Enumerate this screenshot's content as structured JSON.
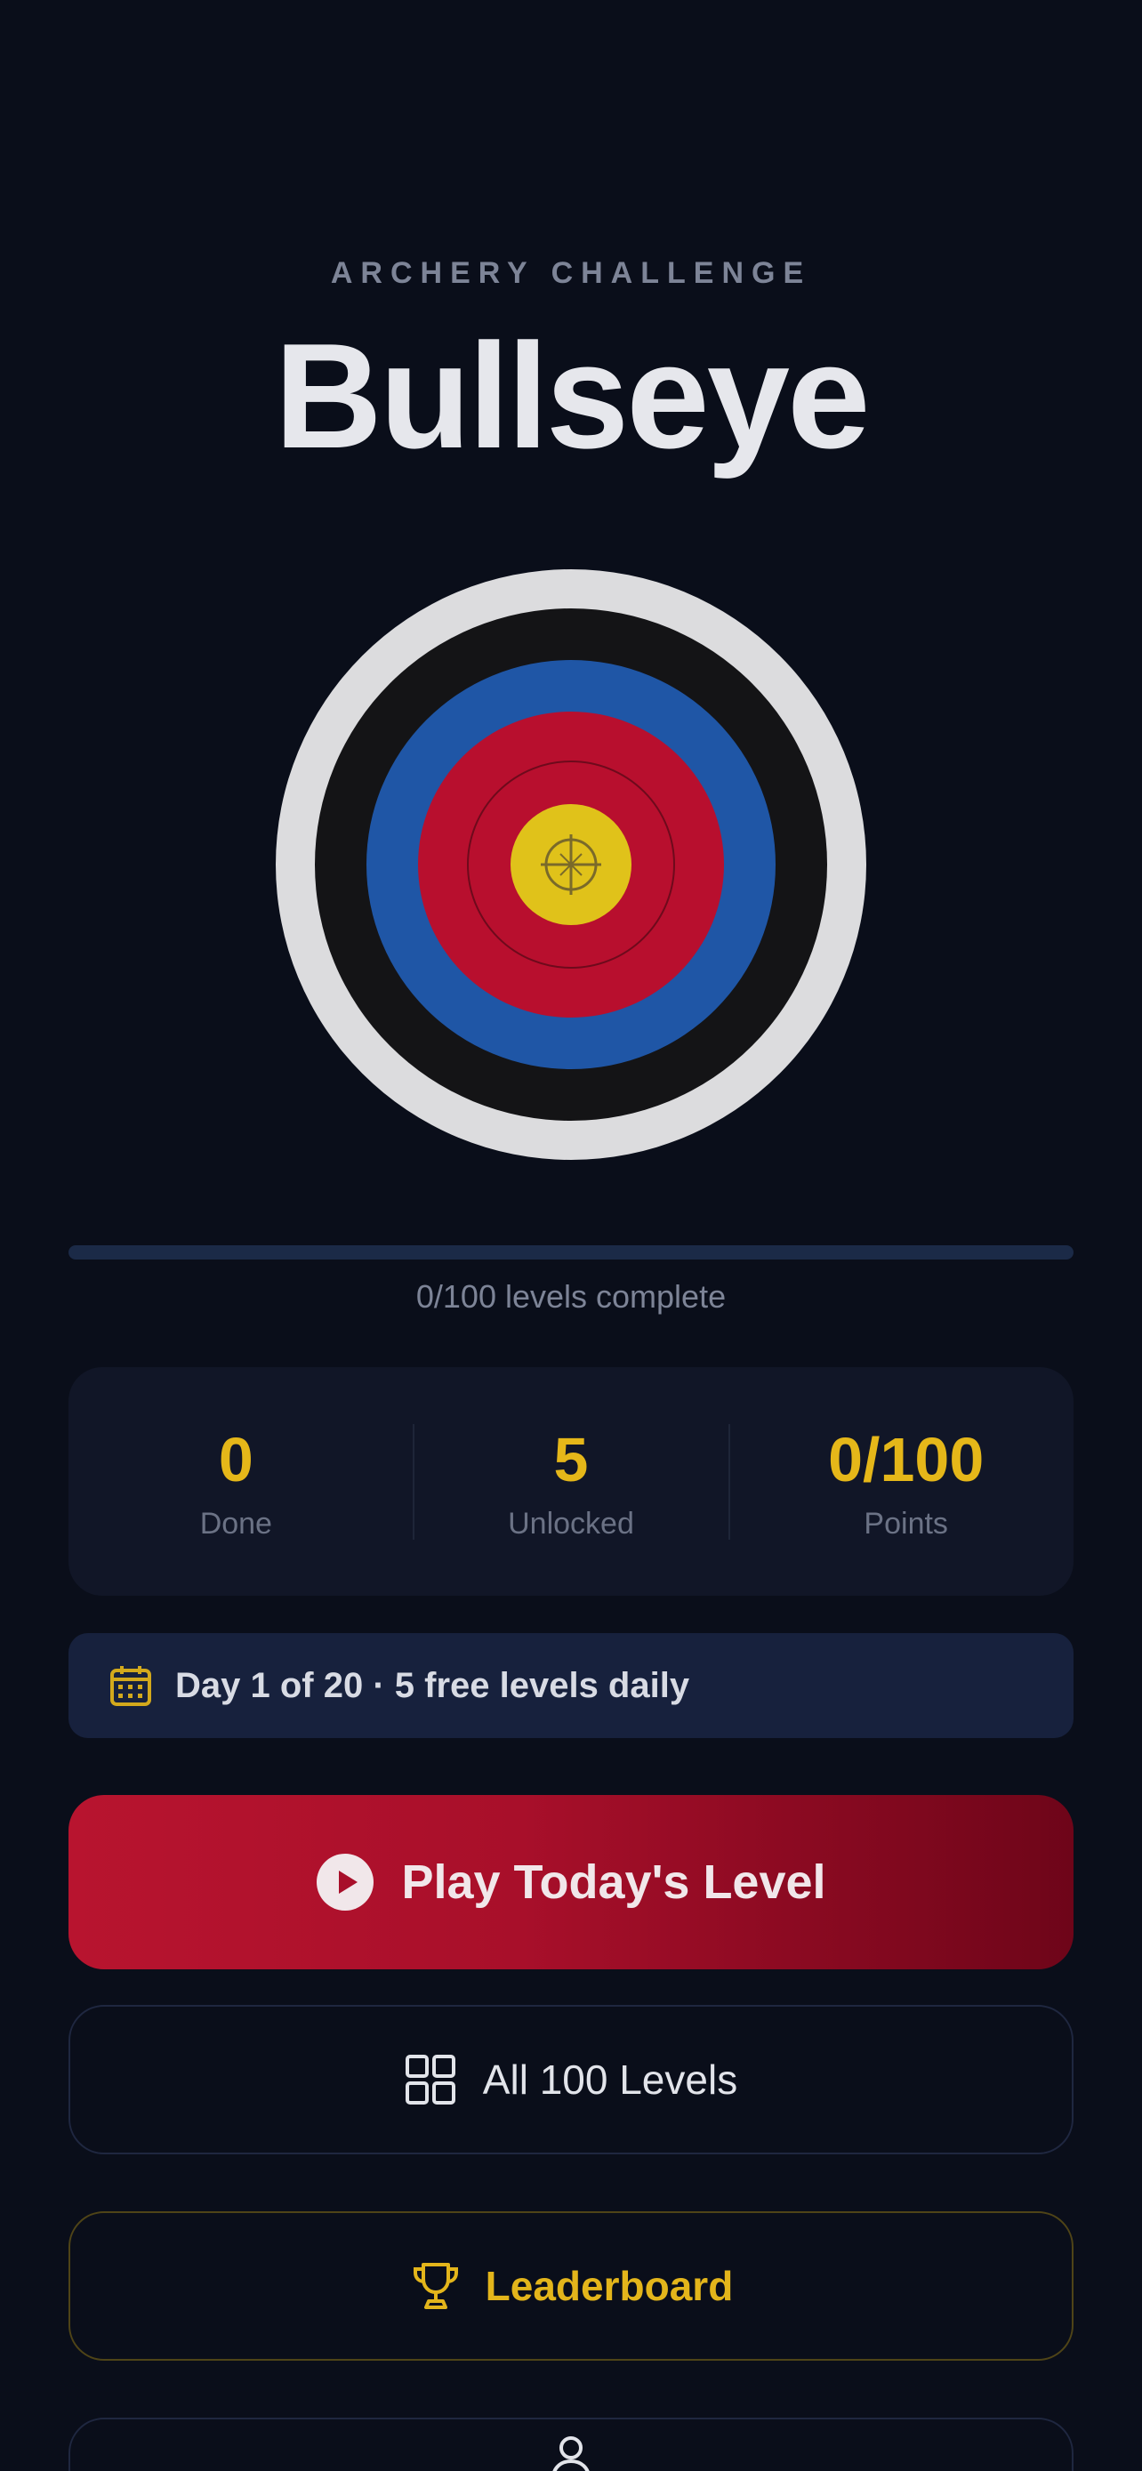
{
  "header": {
    "eyebrow": "ARCHERY CHALLENGE",
    "title": "Bullseye"
  },
  "target": {
    "rings": [
      "#dcdcde",
      "#141416",
      "#1f56a6",
      "#b80f2e",
      "#b80f2e",
      "#e0c21a"
    ],
    "icon": "crosshair-icon"
  },
  "progress": {
    "completed": 0,
    "total": 100,
    "text": "0/100 levels complete",
    "fill_color": "#d6a01d"
  },
  "stats": [
    {
      "value": "0",
      "label": "Done"
    },
    {
      "value": "5",
      "label": "Unlocked"
    },
    {
      "value": "0/100",
      "label": "Points"
    }
  ],
  "day_banner": {
    "icon": "calendar-icon",
    "text": "Day 1 of 20 · 5 free levels daily"
  },
  "buttons": {
    "play": {
      "icon": "play-circle-icon",
      "label": "Play Today's Level"
    },
    "levels": {
      "icon": "grid-icon",
      "label": "All 100 Levels"
    },
    "leaderboard": {
      "icon": "trophy-icon",
      "label": "Leaderboard"
    },
    "more": {
      "icon": "user-icon"
    }
  },
  "colors": {
    "background": "#0a0e1a",
    "accent_gold": "#e3b51b",
    "accent_red": "#b8142f"
  }
}
